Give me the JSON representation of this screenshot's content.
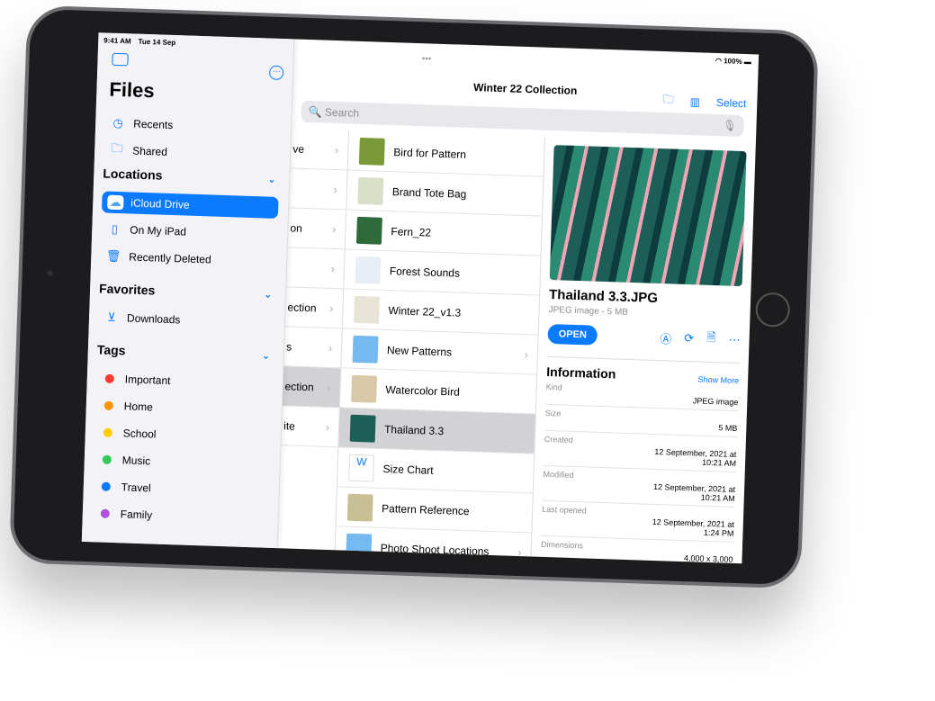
{
  "status": {
    "time": "9:41 AM",
    "date": "Tue 14 Sep",
    "battery": "100%"
  },
  "sidebar": {
    "title": "Files",
    "top": [
      {
        "label": "Recents",
        "icon": "clock-icon"
      },
      {
        "label": "Shared",
        "icon": "shared-folder-icon"
      }
    ],
    "locations_title": "Locations",
    "locations": [
      {
        "label": "iCloud Drive",
        "icon": "cloud-icon",
        "selected": true
      },
      {
        "label": "On My iPad",
        "icon": "ipad-icon"
      },
      {
        "label": "Recently Deleted",
        "icon": "trash-icon"
      }
    ],
    "favorites_title": "Favorites",
    "favorites": [
      {
        "label": "Downloads",
        "icon": "download-icon"
      }
    ],
    "tags_title": "Tags",
    "tags": [
      {
        "label": "Important",
        "color": "#ff3b30"
      },
      {
        "label": "Home",
        "color": "#ff9500"
      },
      {
        "label": "School",
        "color": "#ffcc00"
      },
      {
        "label": "Music",
        "color": "#34c759"
      },
      {
        "label": "Travel",
        "color": "#0a7aff"
      },
      {
        "label": "Family",
        "color": "#af52de"
      }
    ]
  },
  "header": {
    "title": "Winter 22 Collection",
    "select": "Select",
    "search_placeholder": "Search"
  },
  "column2": [
    "ve",
    "",
    "on",
    "",
    "ection",
    "s",
    "ection",
    "ite"
  ],
  "files": [
    {
      "name": "Bird for Pattern",
      "color": "#7a9a3a"
    },
    {
      "name": "Brand Tote Bag",
      "color": "#d8e0c8"
    },
    {
      "name": "Fern_22",
      "color": "#2f6a3a"
    },
    {
      "name": "Forest Sounds",
      "color": "#e8eef6"
    },
    {
      "name": "Winter 22_v1.3",
      "color": "#e8e4d8"
    },
    {
      "name": "New Patterns",
      "color": "#74b9f0",
      "folder": true
    },
    {
      "name": "Watercolor Bird",
      "color": "#d9c9a8"
    },
    {
      "name": "Thailand 3.3",
      "color": "#1d5f56",
      "selected": true
    },
    {
      "name": "Size Chart",
      "color": "#ffffff"
    },
    {
      "name": "Pattern Reference",
      "color": "#c9bf95"
    },
    {
      "name": "Photo Shoot Locations",
      "color": "#74b9f0",
      "folder": true
    }
  ],
  "detail": {
    "name": "Thailand 3.3.JPG",
    "subtitle": "JPEG image - 5 MB",
    "open": "OPEN",
    "info_title": "Information",
    "show_more": "Show More",
    "info": [
      {
        "k": "Kind",
        "v": "JPEG image"
      },
      {
        "k": "Size",
        "v": "5 MB"
      },
      {
        "k": "Created",
        "v": "12 September, 2021 at 10:21 AM"
      },
      {
        "k": "Modified",
        "v": "12 September, 2021 at 10:21 AM"
      },
      {
        "k": "Last opened",
        "v": "12 September, 2021 at 1:24 PM"
      },
      {
        "k": "Dimensions",
        "v": "4,000 x 3,000"
      }
    ]
  }
}
